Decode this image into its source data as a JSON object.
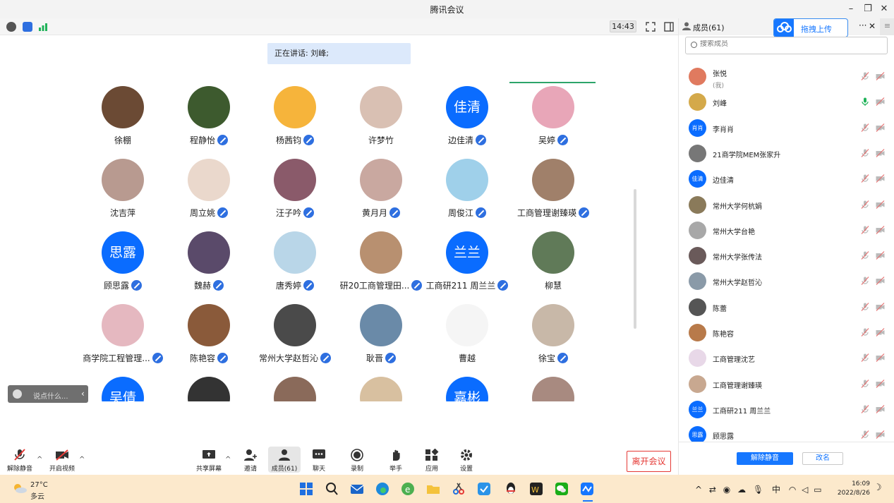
{
  "window": {
    "title": "腾讯会议"
  },
  "toolbar": {
    "clock": "14:43"
  },
  "speaking": {
    "text": "正在讲话: 刘峰;"
  },
  "gallery": {
    "tiles": [
      {
        "name": "徐棚",
        "avatar_text": "",
        "mic_muted": false
      },
      {
        "name": "程静怡",
        "avatar_text": "",
        "mic_muted": true
      },
      {
        "name": "杨茜钧",
        "avatar_text": "",
        "mic_muted": true
      },
      {
        "name": "许梦竹",
        "avatar_text": "",
        "mic_muted": false
      },
      {
        "name": "边佳清",
        "avatar_text": "佳清",
        "mic_muted": true
      },
      {
        "name": "吴婷",
        "avatar_text": "",
        "mic_muted": true
      },
      {
        "name": "沈吉萍",
        "avatar_text": "",
        "mic_muted": false
      },
      {
        "name": "周立姚",
        "avatar_text": "",
        "mic_muted": true
      },
      {
        "name": "汪子吟",
        "avatar_text": "",
        "mic_muted": true
      },
      {
        "name": "黄月月",
        "avatar_text": "",
        "mic_muted": true
      },
      {
        "name": "周俊江",
        "avatar_text": "",
        "mic_muted": true
      },
      {
        "name": "工商管理谢臻瑛",
        "avatar_text": "",
        "mic_muted": true
      },
      {
        "name": "顾思露",
        "avatar_text": "思露",
        "mic_muted": true
      },
      {
        "name": "魏赫",
        "avatar_text": "",
        "mic_muted": true
      },
      {
        "name": "唐秀婷",
        "avatar_text": "",
        "mic_muted": true
      },
      {
        "name": "研20工商管理田...",
        "avatar_text": "",
        "mic_muted": true
      },
      {
        "name": "工商研211 周兰兰",
        "avatar_text": "兰兰",
        "mic_muted": true
      },
      {
        "name": "柳慧",
        "avatar_text": "",
        "mic_muted": false
      },
      {
        "name": "商学院工程管理...",
        "avatar_text": "",
        "mic_muted": true
      },
      {
        "name": "陈艳容",
        "avatar_text": "",
        "mic_muted": true
      },
      {
        "name": "常州大学赵哲沁",
        "avatar_text": "",
        "mic_muted": true
      },
      {
        "name": "耿晋",
        "avatar_text": "",
        "mic_muted": true
      },
      {
        "name": "曹越",
        "avatar_text": "",
        "mic_muted": false
      },
      {
        "name": "徐宝",
        "avatar_text": "",
        "mic_muted": true
      },
      {
        "name": "",
        "avatar_text": "吴倩",
        "mic_muted": false
      },
      {
        "name": "",
        "avatar_text": "",
        "mic_muted": false
      },
      {
        "name": "",
        "avatar_text": "",
        "mic_muted": false
      },
      {
        "name": "",
        "avatar_text": "",
        "mic_muted": false
      },
      {
        "name": "",
        "avatar_text": "嘉彬",
        "mic_muted": false
      },
      {
        "name": "",
        "avatar_text": "",
        "mic_muted": false
      }
    ]
  },
  "chat": {
    "placeholder": "说点什么..."
  },
  "bottom_toolbar": {
    "unmute": "解除静音",
    "start_video": "开启视频",
    "share_screen": "共享屏幕",
    "invite": "邀请",
    "members": "成员(61)",
    "chat": "聊天",
    "record": "录制",
    "raise_hand": "举手",
    "apps": "应用",
    "settings": "设置",
    "leave": "离开会议"
  },
  "panel": {
    "title": "成员(61)",
    "upload_label": "拖拽上传",
    "search_placeholder": "搜索成员",
    "members": [
      {
        "name": "张悦",
        "sub": "(我)",
        "avatar_text": "",
        "mic_on": false
      },
      {
        "name": "刘峰",
        "sub": "",
        "avatar_text": "",
        "mic_on": true
      },
      {
        "name": "李肖肖",
        "sub": "",
        "avatar_text": "肖肖",
        "mic_on": false
      },
      {
        "name": "21商学院MEM张家升",
        "sub": "",
        "avatar_text": "",
        "mic_on": false
      },
      {
        "name": "边佳清",
        "sub": "",
        "avatar_text": "佳清",
        "mic_on": false
      },
      {
        "name": "常州大学何杭娟",
        "sub": "",
        "avatar_text": "",
        "mic_on": false
      },
      {
        "name": "常州大学台艳",
        "sub": "",
        "avatar_text": "",
        "mic_on": false
      },
      {
        "name": "常州大学张传法",
        "sub": "",
        "avatar_text": "",
        "mic_on": false
      },
      {
        "name": "常州大学赵哲沁",
        "sub": "",
        "avatar_text": "",
        "mic_on": false
      },
      {
        "name": "陈蕾",
        "sub": "",
        "avatar_text": "",
        "mic_on": false
      },
      {
        "name": "陈艳容",
        "sub": "",
        "avatar_text": "",
        "mic_on": false
      },
      {
        "name": "工商管理沈艺",
        "sub": "",
        "avatar_text": "",
        "mic_on": false
      },
      {
        "name": "工商管理谢臻瑛",
        "sub": "",
        "avatar_text": "",
        "mic_on": false
      },
      {
        "name": "工商研211 周兰兰",
        "sub": "",
        "avatar_text": "兰兰",
        "mic_on": false
      },
      {
        "name": "顾思露",
        "sub": "",
        "avatar_text": "思露",
        "mic_on": false
      }
    ],
    "unmute_all": "解除静音",
    "rename": "改名"
  },
  "taskbar": {
    "weather_temp": "27°C",
    "weather_desc": "多云",
    "tray_ime": "中",
    "time": "16:09",
    "date": "2022/8/26"
  },
  "colors": {
    "accent": "#0a6cff",
    "leave": "#e53935",
    "taskbar": "#fce9cc"
  }
}
